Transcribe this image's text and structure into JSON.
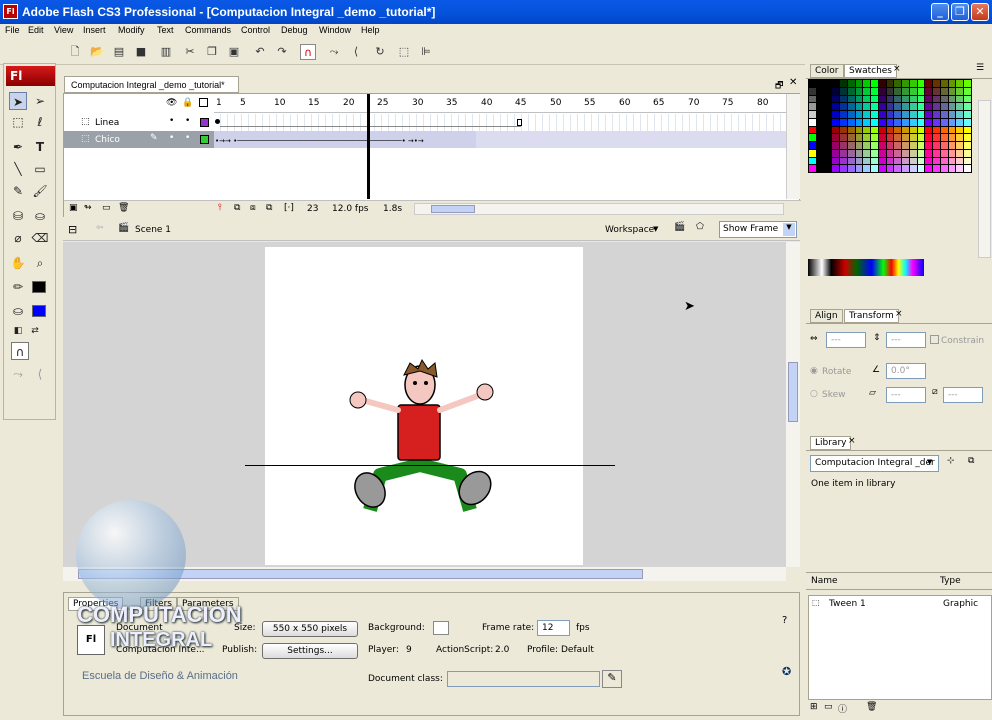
{
  "window": {
    "title": "Adobe Flash CS3 Professional - [Computacion Integral _demo _tutorial*]",
    "app_icon": "Fl",
    "minimize": "_",
    "maximize": "❐",
    "close": "✕"
  },
  "menu": [
    "File",
    "Edit",
    "View",
    "Insert",
    "Modify",
    "Text",
    "Commands",
    "Control",
    "Debug",
    "Window",
    "Help"
  ],
  "tools": {
    "logo": "Fl"
  },
  "document": {
    "tab": "Computacion Integral _demo _tutorial*"
  },
  "timeline": {
    "ruler": [
      "1",
      "5",
      "10",
      "15",
      "20",
      "25",
      "30",
      "35",
      "40",
      "45",
      "50",
      "55",
      "60",
      "65",
      "70",
      "75",
      "80"
    ],
    "layers": [
      {
        "name": "Linea",
        "color": "#9933cc"
      },
      {
        "name": "Chico",
        "color": "#33cc33"
      }
    ],
    "current_frame": "23",
    "fps": "12.0 fps",
    "time": "1.8s"
  },
  "editbar": {
    "scene": "Scene 1",
    "workspace": "Workspace",
    "show_frame": "Show Frame"
  },
  "properties": {
    "tabs": [
      "Properties",
      "Filters",
      "Parameters"
    ],
    "doc_label": "Document",
    "doc_name": "Computacion Inte...",
    "size_label": "Size:",
    "size_value": "550 x 550 pixels",
    "background_label": "Background:",
    "frame_rate_label": "Frame rate:",
    "frame_rate_value": "12",
    "fps_unit": "fps",
    "publish_label": "Publish:",
    "settings_button": "Settings...",
    "player_label": "Player:",
    "player_value": "9",
    "actionscript_label": "ActionScript:",
    "actionscript_value": "2.0",
    "profile_label": "Profile:",
    "profile_value": "Default",
    "doc_class_label": "Document class:"
  },
  "watermark": {
    "title": "COMPUTACION",
    "subtitle": "INTEGRAL",
    "tagline": "Escuela de Diseño & Animación"
  },
  "right_panels": {
    "color_tabs": [
      "Color",
      "Swatches"
    ],
    "transform_tabs": [
      "Align",
      "Transform"
    ],
    "transform": {
      "w": "---",
      "h": "---",
      "constrain": "Constrain",
      "rotate_label": "Rotate",
      "rotate_value": "0.0°",
      "skew_label": "Skew",
      "skew1": "---",
      "skew2": "---"
    },
    "library_tab": "Library",
    "library_doc": "Computacion Integral _der",
    "library_count": "One item in library",
    "columns": [
      "Name",
      "Type"
    ],
    "items": [
      {
        "name": "Tween 1",
        "type": "Graphic"
      }
    ]
  }
}
